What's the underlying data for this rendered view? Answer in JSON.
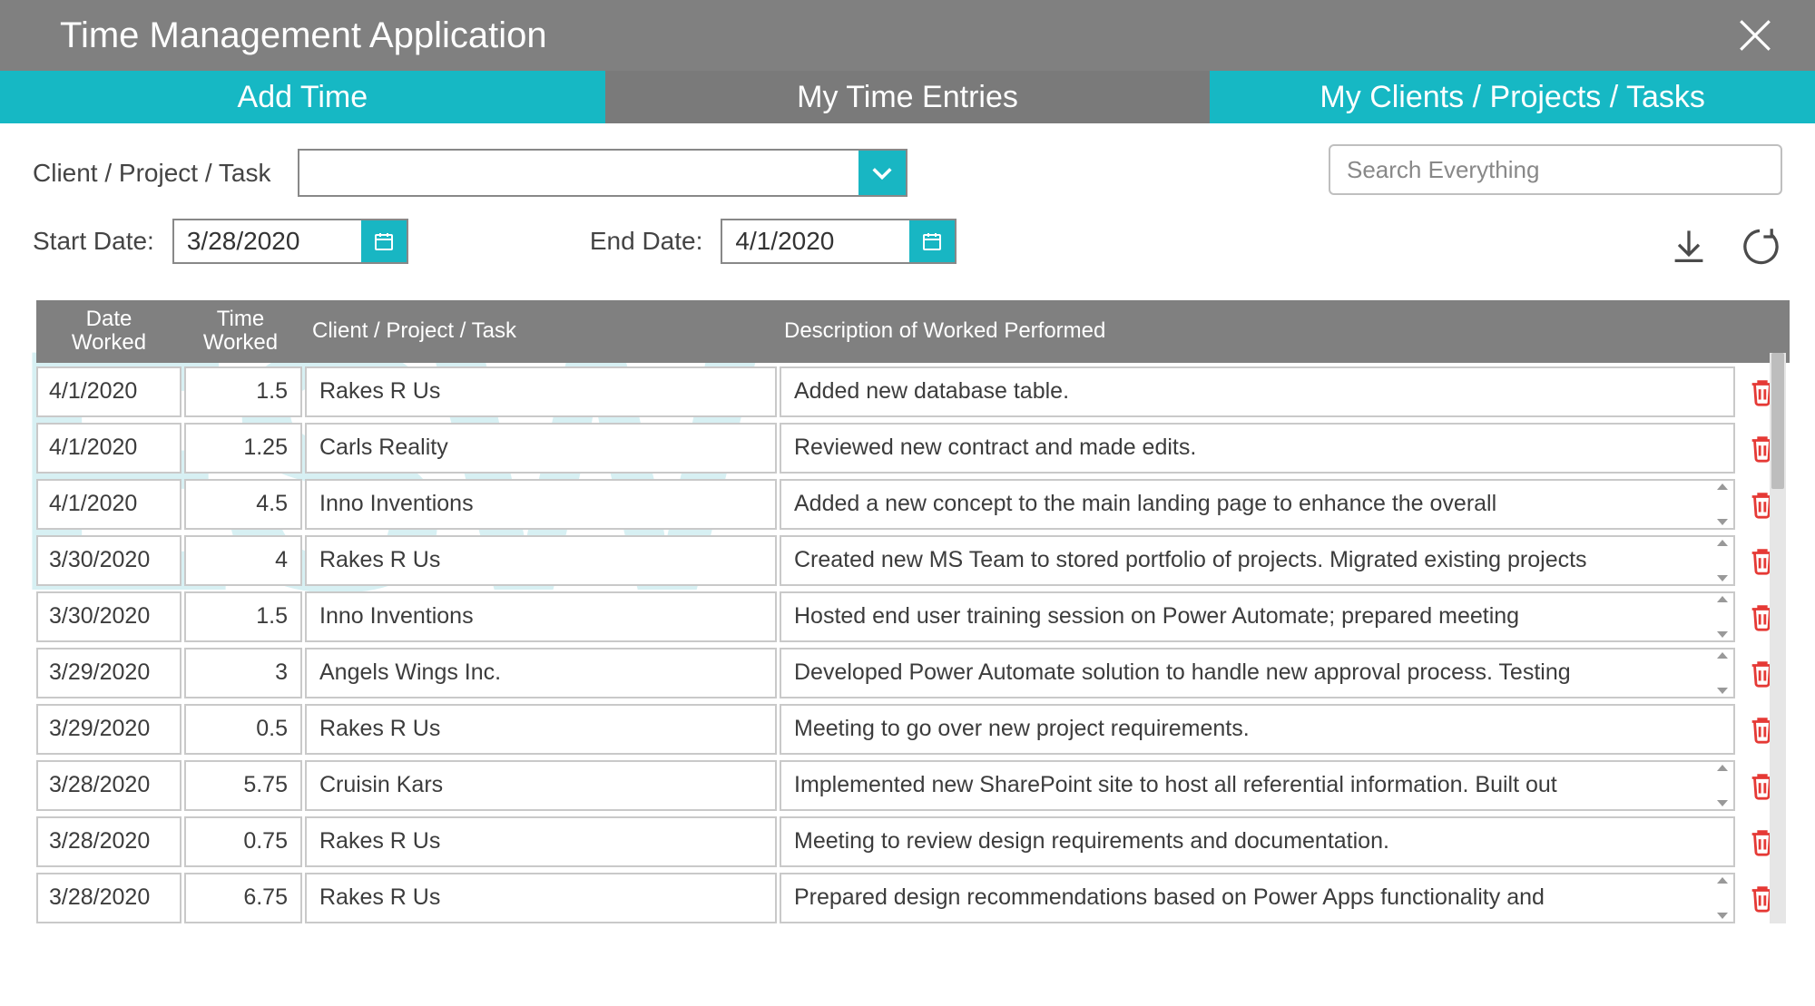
{
  "window": {
    "title": "Time Management Application"
  },
  "nav": {
    "tab1": "Add Time",
    "tab2": "My Time Entries",
    "tab3": "My Clients / Projects / Tasks",
    "active_index": 1
  },
  "filters": {
    "cpt_label": "Client / Project / Task",
    "cpt_selected": "",
    "start_label": "Start Date:",
    "start_value": "3/28/2020",
    "end_label": "End Date:",
    "end_value": "4/1/2020",
    "search_placeholder": "Search Everything"
  },
  "table": {
    "headers": {
      "date": "Date Worked",
      "time": "Time Worked",
      "cpt": "Client / Project / Task",
      "desc": "Description of Worked Performed"
    },
    "rows": [
      {
        "date": "4/1/2020",
        "time": "1.5",
        "cpt": "Rakes R Us",
        "desc": "Added new database table.",
        "overflow": false
      },
      {
        "date": "4/1/2020",
        "time": "1.25",
        "cpt": "Carls Reality",
        "desc": "Reviewed new contract and made edits.",
        "overflow": false
      },
      {
        "date": "4/1/2020",
        "time": "4.5",
        "cpt": "Inno Inventions",
        "desc": "Added a new concept to the main landing page to enhance the overall",
        "overflow": true
      },
      {
        "date": "3/30/2020",
        "time": "4",
        "cpt": "Rakes R Us",
        "desc": "Created new MS Team to stored portfolio of projects.  Migrated existing projects",
        "overflow": true
      },
      {
        "date": "3/30/2020",
        "time": "1.5",
        "cpt": "Inno Inventions",
        "desc": "Hosted end user training session on Power Automate; prepared meeting",
        "overflow": true
      },
      {
        "date": "3/29/2020",
        "time": "3",
        "cpt": "Angels Wings Inc.",
        "desc": "Developed Power Automate solution to handle new approval process.  Testing",
        "overflow": true
      },
      {
        "date": "3/29/2020",
        "time": "0.5",
        "cpt": "Rakes R Us",
        "desc": "Meeting to go over new project requirements.",
        "overflow": false
      },
      {
        "date": "3/28/2020",
        "time": "5.75",
        "cpt": "Cruisin Kars",
        "desc": "Implemented new SharePoint site to host all referential information.  Built out",
        "overflow": true
      },
      {
        "date": "3/28/2020",
        "time": "0.75",
        "cpt": "Rakes R Us",
        "desc": "Meeting to review design requirements and documentation.",
        "overflow": false
      },
      {
        "date": "3/28/2020",
        "time": "6.75",
        "cpt": "Rakes R Us",
        "desc": "Prepared design recommendations based on Power Apps functionality and",
        "overflow": true
      }
    ]
  }
}
